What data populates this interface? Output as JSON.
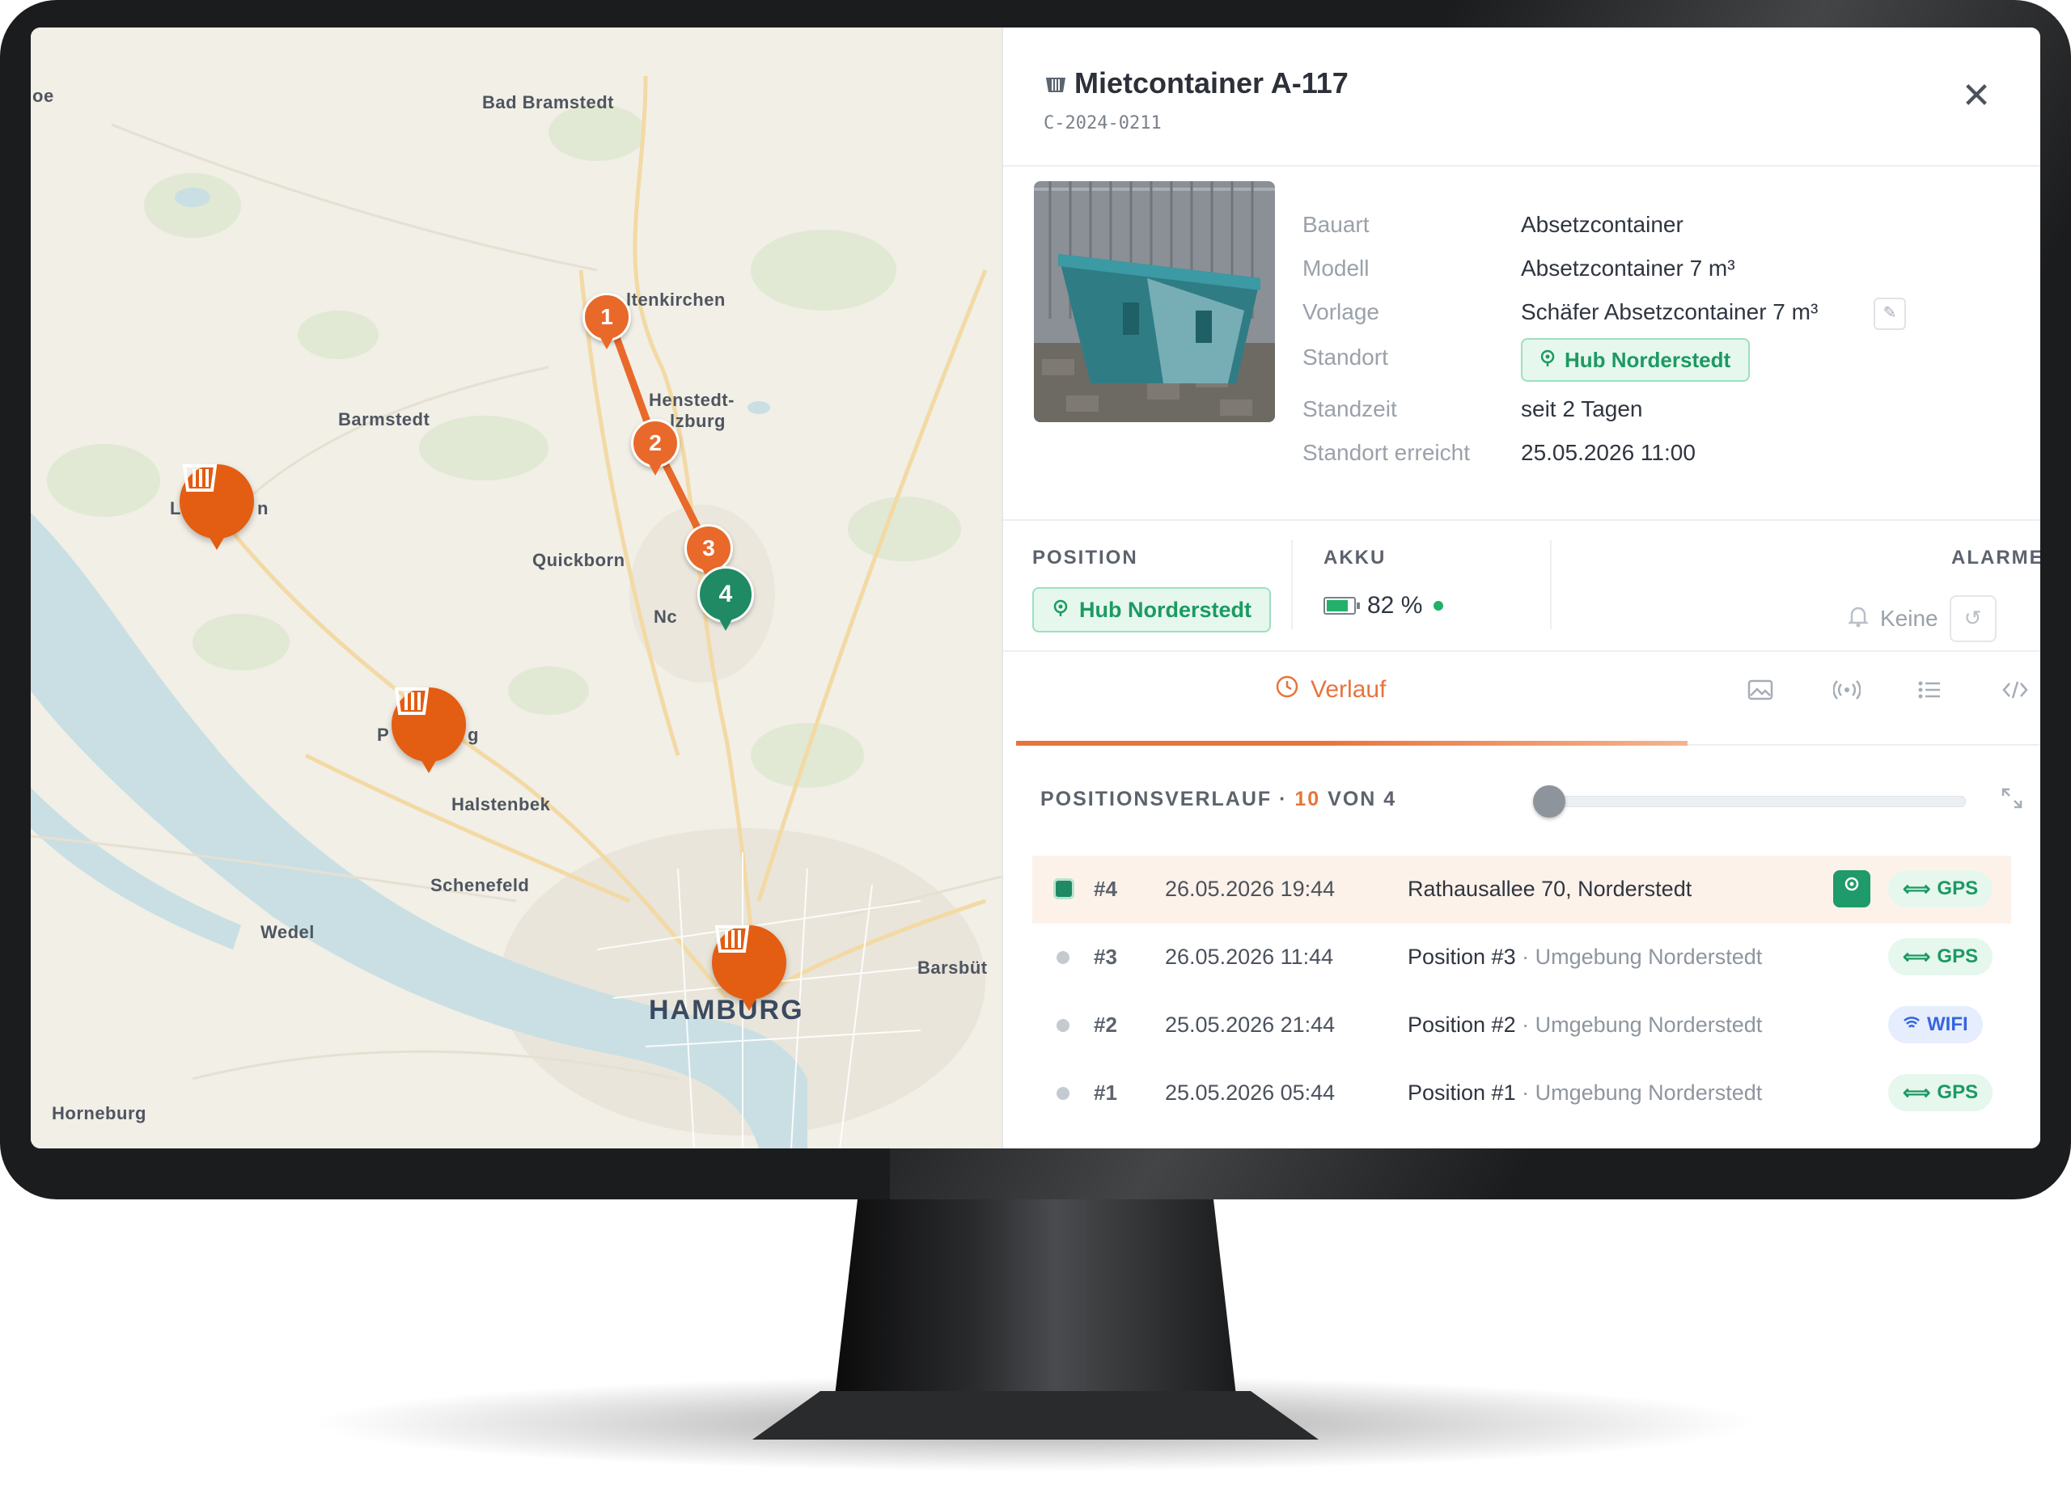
{
  "map": {
    "cities": [
      {
        "name": "oe",
        "big": false
      },
      {
        "name": "Bad Bramstedt",
        "big": false
      },
      {
        "name": "ltenkirchen",
        "big": false
      },
      {
        "name": "Barmstedt",
        "big": false
      },
      {
        "name": "Henstedt-",
        "big": false
      },
      {
        "name": "lzburg",
        "big": false
      },
      {
        "name": "Quickborn",
        "big": false
      },
      {
        "name": "Nc",
        "big": false
      },
      {
        "name": "Halstenbek",
        "big": false
      },
      {
        "name": "Schenefeld",
        "big": false
      },
      {
        "name": "Wedel",
        "big": false
      },
      {
        "name": "Barsbüt",
        "big": false
      },
      {
        "name": "HAMBURG",
        "big": true
      },
      {
        "name": "Horneburg",
        "big": false
      },
      {
        "name": "L",
        "big": false
      },
      {
        "name": "n",
        "big": false
      },
      {
        "name": "P",
        "big": false
      },
      {
        "name": "g",
        "big": false
      }
    ],
    "route_pins": [
      "1",
      "2",
      "3",
      "4"
    ],
    "container_pin_icon": "container-icon",
    "colors": {
      "route": "#e9692a",
      "current": "#1f8a64",
      "container_pin": "#e35d12"
    }
  },
  "panel": {
    "title": "Mietcontainer A-117",
    "subid": "C-2024-0211",
    "close": "✕",
    "properties": [
      {
        "label": "Bauart",
        "value": "Absetzcontainer"
      },
      {
        "label": "Modell",
        "value": "Absetzcontainer 7 m³"
      },
      {
        "label": "Vorlage",
        "value": "Schäfer Absetzcontainer 7 m³"
      },
      {
        "label": "Standort",
        "value": "Hub Norderstedt"
      },
      {
        "label": "Standzeit",
        "value": "seit 2 Tagen"
      },
      {
        "label": "Standort erreicht",
        "value": "25.05.2026 11:00"
      }
    ],
    "stats": {
      "position_label": "POSITION",
      "position_value": "Hub Norderstedt",
      "akku_label": "AKKU",
      "akku_value": "82 %",
      "akku_level": 0.82,
      "alarme_label": "ALARME",
      "alarme_value": "Keine"
    },
    "tabs": {
      "active": "Verlauf",
      "icons": [
        "image-icon",
        "signal-icon",
        "list-icon",
        "code-icon"
      ]
    },
    "history": {
      "title": "POSITIONSVERLAUF",
      "sep": " · ",
      "count": "10",
      "of": " VON 4",
      "slider_value": 0,
      "rows": [
        {
          "num": "#4",
          "time": "26.05.2026 19:44",
          "addr": "Rathausallee 70, Norderstedt",
          "addr_dim": "",
          "source": "GPS",
          "current": true
        },
        {
          "num": "#3",
          "time": "26.05.2026 11:44",
          "addr": "Position #3",
          "addr_dim": " · Umgebung Norderstedt",
          "source": "GPS",
          "current": false
        },
        {
          "num": "#2",
          "time": "25.05.2026 21:44",
          "addr": "Position #2",
          "addr_dim": " · Umgebung Norderstedt",
          "source": "WIFI",
          "current": false
        },
        {
          "num": "#1",
          "time": "25.05.2026 05:44",
          "addr": "Position #1",
          "addr_dim": " · Umgebung Norderstedt",
          "source": "GPS",
          "current": false
        }
      ]
    }
  }
}
